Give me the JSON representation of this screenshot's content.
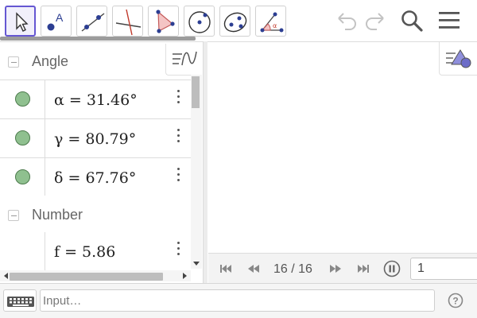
{
  "toolbar": {
    "tools": [
      {
        "name": "move-tool"
      },
      {
        "name": "point-tool"
      },
      {
        "name": "line-tool"
      },
      {
        "name": "perpendicular-line-tool"
      },
      {
        "name": "polygon-tool"
      },
      {
        "name": "circle-center-point-tool"
      },
      {
        "name": "conic-tool"
      },
      {
        "name": "angle-tool"
      }
    ],
    "actions": [
      "undo-icon",
      "redo-icon",
      "search-icon",
      "menu-icon"
    ],
    "point_label": "A",
    "angle_symbol": "α"
  },
  "algebra": {
    "groups": [
      {
        "title": "Angle",
        "items": [
          {
            "label": "α = 31.46°"
          },
          {
            "label": "γ = 80.79°"
          },
          {
            "label": "δ = 67.76°"
          }
        ]
      },
      {
        "title": "Number",
        "items": [
          {
            "label": "f = 5.86"
          }
        ]
      }
    ]
  },
  "playbar": {
    "step": "16 / 16",
    "speed": "1"
  },
  "inputbar": {
    "placeholder": "Input…",
    "help": "?"
  },
  "colors": {
    "accent": "#6557d2",
    "marble": "#8fc08f",
    "polygon_fill": "#f4c4c4",
    "polygon_stroke": "#c45a5a"
  }
}
